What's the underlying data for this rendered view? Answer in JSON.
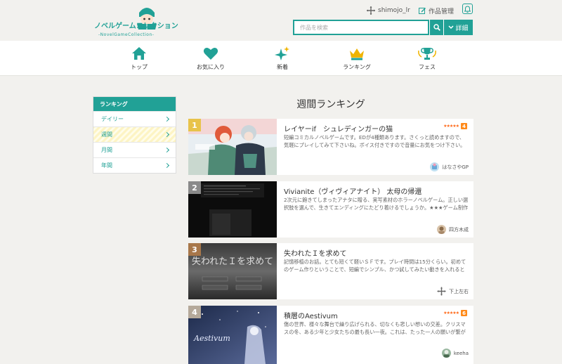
{
  "site": {
    "logo_title": "ノベルゲームコレクション",
    "logo_subtitle": "-NovelGameCollection-"
  },
  "header": {
    "username": "shimojo_lr",
    "works_label": "作品管理",
    "search_placeholder": "作品を検索",
    "detail_label": "詳細"
  },
  "nav": [
    {
      "label": "トップ",
      "icon": "home-icon"
    },
    {
      "label": "お気に入り",
      "icon": "heart-icon"
    },
    {
      "label": "新着",
      "icon": "sparkle-icon"
    },
    {
      "label": "ランキング",
      "icon": "crown-icon"
    },
    {
      "label": "フェス",
      "icon": "trophy-icon"
    }
  ],
  "sidebar": {
    "title": "ランキング",
    "items": [
      {
        "label": "デイリー",
        "active": false
      },
      {
        "label": "週間",
        "active": true
      },
      {
        "label": "月間",
        "active": false
      },
      {
        "label": "年間",
        "active": false
      }
    ]
  },
  "main": {
    "title": "週間ランキング"
  },
  "rankings": [
    {
      "rank": "1",
      "title": "レイヤーif　シュレディンガーの猫",
      "description": "短編コミカルノベルゲームです。EDが4種類あります。さくっと読めますので、気軽にプレイしてみて下さいね。ボイス付きですので音量にお気をつけ下さい。一部、…",
      "stars": "★★★★★",
      "count": "4",
      "author": "はなさやGP"
    },
    {
      "rank": "2",
      "title": "Vivianite（ヴィヴィアナイト） 太母の帰還",
      "description": "2次元に飽きてしまったアナタに贈る、実写素材のホラーノベルゲーム。正しい選択肢を選んで、生きてエンディングにたどり着けるでしょうか。★★★ゲーム制作を…",
      "stars": "",
      "count": "",
      "author": "四方木成"
    },
    {
      "rank": "3",
      "title": "失われたＩを求めて",
      "description": "記憶移植のお話。とても短くて軽いＳＦです。プレイ時間は15分くらい。初めてのゲーム作りということで、短編でシンプル、かつ試してみたい動きを入れるというか…",
      "stars": "",
      "count": "",
      "author": "下上左右"
    },
    {
      "rank": "4",
      "title": "積層のAestivum",
      "description": "傷の世界、様々な舞台で繰り広げられる、切なくも悲しい想いの交差。クリスマスの冬、ある少年と少女たちの最も長い一夜。これは、たった一人の願いが繋がり、そ…",
      "stars": "★★★★★",
      "count": "6",
      "author": "keeha"
    }
  ],
  "colors": {
    "accent": "#21a196",
    "rank1": "#e8c34a",
    "rank2": "#8a8a8a",
    "rank3": "#a8774a",
    "rank4": "#b5a99a",
    "star": "#ff6a1a"
  }
}
